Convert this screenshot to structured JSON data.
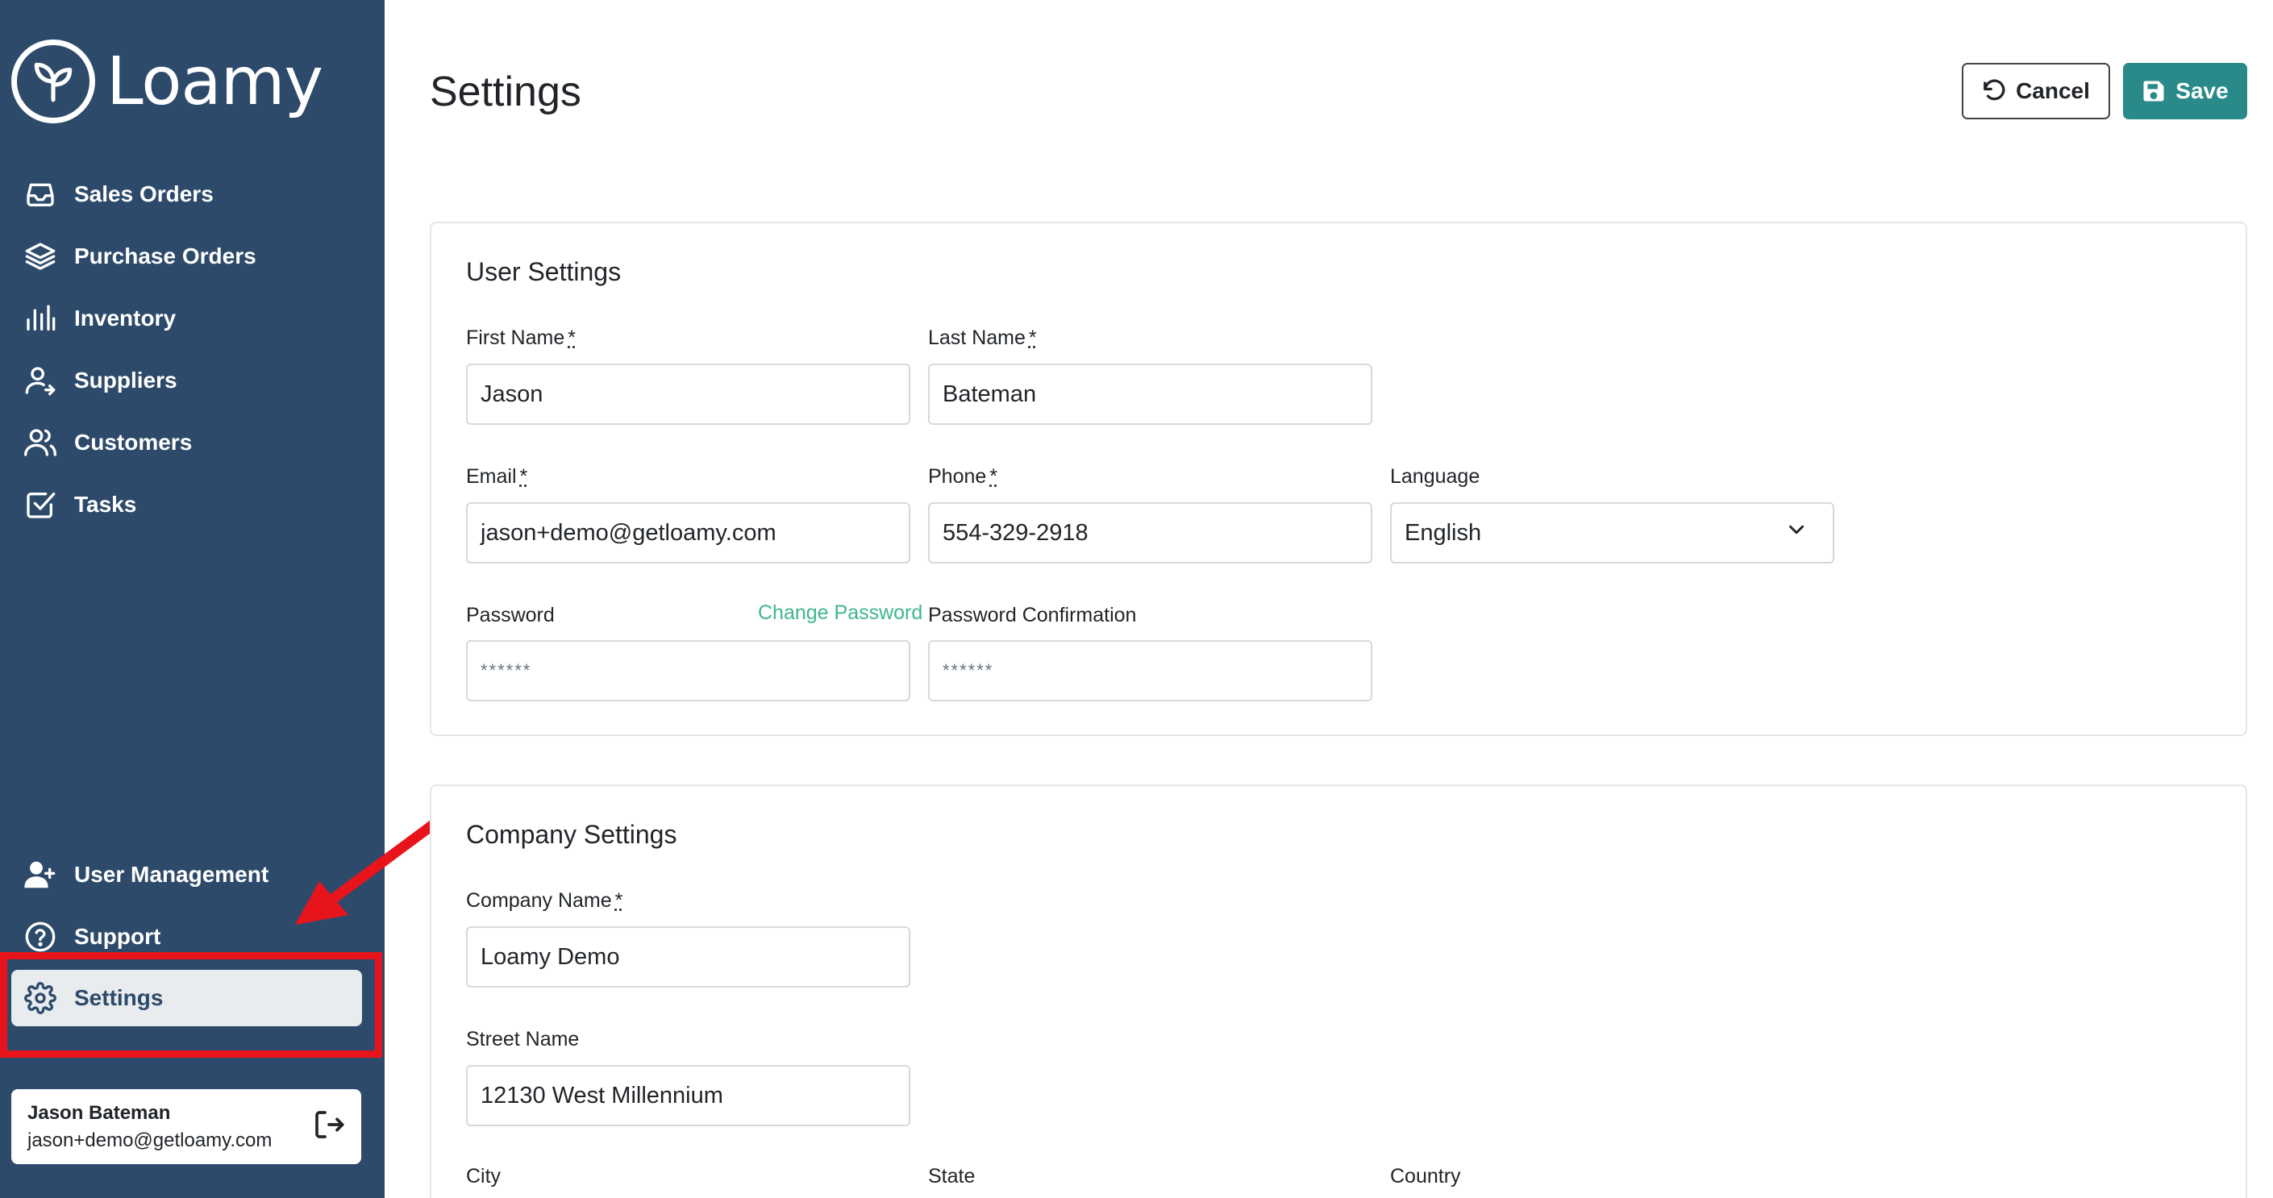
{
  "brand": {
    "name": "Loamy"
  },
  "sidebar": {
    "top_items": [
      {
        "label": "Sales Orders",
        "icon": "inbox-icon"
      },
      {
        "label": "Purchase Orders",
        "icon": "layers-icon"
      },
      {
        "label": "Inventory",
        "icon": "bars-icon"
      },
      {
        "label": "Suppliers",
        "icon": "user-arrow-icon"
      },
      {
        "label": "Customers",
        "icon": "users-icon"
      },
      {
        "label": "Tasks",
        "icon": "checkbox-icon"
      }
    ],
    "bottom_items": [
      {
        "label": "User Management",
        "icon": "user-plus-icon"
      },
      {
        "label": "Support",
        "icon": "help-circle-icon"
      }
    ],
    "active_item": {
      "label": "Settings",
      "icon": "gear-icon"
    },
    "user": {
      "name": "Jason Bateman",
      "email": "jason+demo@getloamy.com"
    }
  },
  "header": {
    "title": "Settings",
    "cancel_label": "Cancel",
    "save_label": "Save"
  },
  "user_settings": {
    "title": "User Settings",
    "first_name_label": "First Name",
    "first_name_value": "Jason",
    "last_name_label": "Last Name",
    "last_name_value": "Bateman",
    "email_label": "Email",
    "email_value": "jason+demo@getloamy.com",
    "phone_label": "Phone",
    "phone_value": "554-329-2918",
    "language_label": "Language",
    "language_value": "English",
    "password_label": "Password",
    "change_password_label": "Change Password",
    "password_value": "******",
    "password_confirmation_label": "Password Confirmation",
    "password_confirmation_value": "******"
  },
  "company_settings": {
    "title": "Company Settings",
    "company_name_label": "Company Name",
    "company_name_value": "Loamy Demo",
    "street_name_label": "Street Name",
    "street_name_value": "12130 West Millennium",
    "city_label": "City",
    "state_label": "State",
    "country_label": "Country"
  },
  "required_marker": "*",
  "colors": {
    "sidebar_bg": "#2d4a6b",
    "save_bg": "#2a8a8a",
    "link": "#3fb68f",
    "highlight": "#e8141c"
  }
}
